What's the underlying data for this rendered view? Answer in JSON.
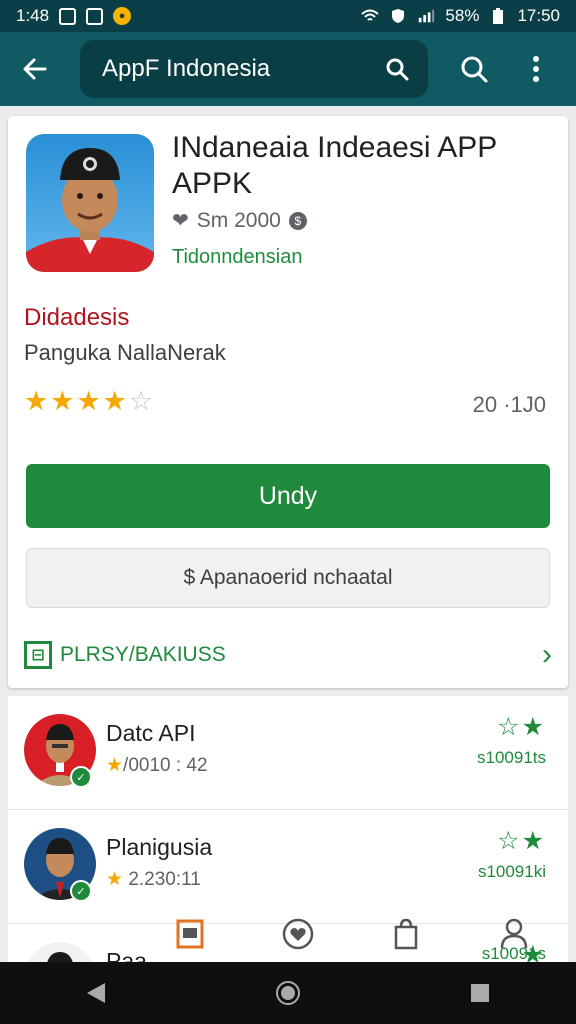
{
  "status_bar": {
    "time_left": "1:48",
    "battery": "58%",
    "time_right": "17:50"
  },
  "app_bar": {
    "search_text": "AppF Indonesia"
  },
  "app": {
    "title": "INdaneaia Indeaesi APP APPK",
    "meta": "Sm 2000",
    "developer": "Tidonndensian",
    "category": "Didadesis",
    "subtitle": "Panguka NallaNerak",
    "rating": 4,
    "rating_max": 5,
    "rating_count": "20 ·1J0",
    "install_label": "Undy",
    "secondary_label": "$ Apanaoerid nchaatal",
    "link_label": "PLRSY/BAKIUSS"
  },
  "list": [
    {
      "title": "Datc API",
      "sub": "/0010 : 42",
      "count": "s10091ts",
      "star_outline": "☆",
      "star_filled": "★"
    },
    {
      "title": "Planigusia",
      "sub": "2.230:11",
      "count": "s10091ki",
      "star_outline": "☆",
      "star_filled": "★"
    },
    {
      "title": "Paa",
      "sub": "",
      "count": "s10091s",
      "star_outline": "",
      "star_filled": "★"
    }
  ],
  "colors": {
    "app_bar": "#0f5a63",
    "status_bar": "#0b3f47",
    "install": "#1f8a3b",
    "star": "#f5a800",
    "category": "#b3131b"
  },
  "icons": {
    "back": "arrow-left-icon",
    "search": "search-icon",
    "menu": "more-vert-icon",
    "nav": [
      "store-icon",
      "heart-icon",
      "bag-icon",
      "person-icon"
    ],
    "system": [
      "back-triangle-icon",
      "home-circle-icon",
      "recents-square-icon"
    ]
  }
}
